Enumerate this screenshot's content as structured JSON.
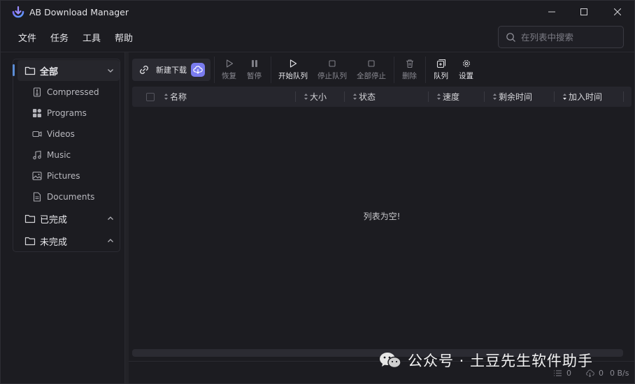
{
  "app": {
    "title": "AB Download Manager"
  },
  "menu": [
    "文件",
    "任务",
    "工具",
    "帮助"
  ],
  "search": {
    "placeholder": "在列表中搜索",
    "value": ""
  },
  "sidebar": {
    "all": "全部",
    "categories": [
      "Compressed",
      "Programs",
      "Videos",
      "Music",
      "Pictures",
      "Documents"
    ],
    "completed": "已完成",
    "unfinished": "未完成"
  },
  "toolbar": {
    "new_download": "新建下载",
    "resume": "恢复",
    "pause": "暂停",
    "start_queue": "开始队列",
    "stop_queue": "停止队列",
    "stop_all": "全部停止",
    "delete": "删除",
    "queue": "队列",
    "settings": "设置"
  },
  "table": {
    "columns": [
      "名称",
      "大小",
      "状态",
      "速度",
      "剩余时间",
      "加入时间"
    ],
    "empty_message": "列表为空!"
  },
  "status": {
    "active_count": "0",
    "download_count": "0",
    "speed": "0 B/s"
  },
  "watermark": "公众号 · 土豆先生软件助手",
  "colors": {
    "accent": "#5b8dd6",
    "cloud_button": "#7a7cf0",
    "background": "#1c1c21"
  }
}
